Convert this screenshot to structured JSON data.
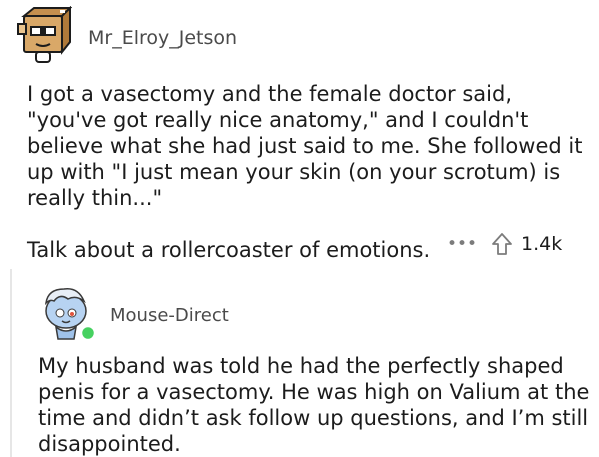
{
  "top_comment": {
    "username": "Mr_Elroy_Jetson",
    "paragraphs": [
      "I got a vasectomy and the female doctor said, \"you've got really nice anatomy,\" and I couldn't believe what she had just said to me.  She followed it up with \"I just mean your skin (on your scrotum) is really thin...\"",
      "Talk about a rollercoaster of emotions."
    ],
    "more_icon": "more-icon",
    "upvote_icon": "upvote-icon",
    "score": "1.4k"
  },
  "reply": {
    "username": "Mouse-Direct",
    "online_status_color": "#46d160",
    "text": "My husband was told he had the perfectly shaped penis for a vasectomy. He was high on Valium at the time and didn’t ask follow up questions, and I’m still disappointed."
  }
}
